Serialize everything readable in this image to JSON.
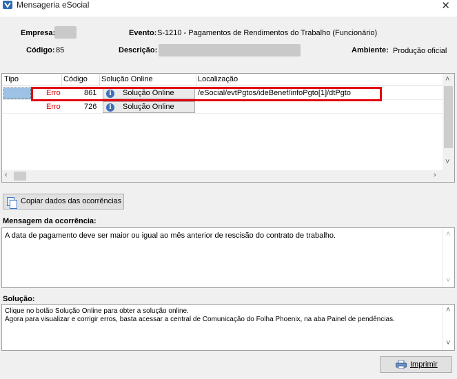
{
  "window": {
    "title": "Mensageria eSocial",
    "close_glyph": "✕"
  },
  "header": {
    "empresa_label": "Empresa:",
    "codigo_label": "Código:",
    "codigo_value": "85",
    "evento_label": "Evento:",
    "evento_value": "S-1210 - Pagamentos de Rendimentos do Trabalho (Funcionário)",
    "descricao_label": "Descrição:",
    "ambiente_label": "Ambiente:",
    "ambiente_value": "Produção oficial"
  },
  "grid": {
    "columns": [
      "Tipo",
      "Código",
      "Solução Online",
      "Localização"
    ],
    "rows": [
      {
        "tipo": "Erro",
        "codigo": "861",
        "solucao": "Solução Online",
        "localizacao": "/eSocial/evtPgtos/ideBenef/infoPgto[1]/dtPgto",
        "selected": true
      },
      {
        "tipo": "Erro",
        "codigo": "726",
        "solucao": "Solução Online",
        "localizacao": "",
        "selected": false
      }
    ]
  },
  "copy_button": {
    "label": "Copiar dados das ocorrências",
    "icon": "copy-icon"
  },
  "mensagem": {
    "label": "Mensagem da ocorrência:",
    "text": "A data de pagamento deve ser maior ou igual ao mês anterior de rescisão do contrato de trabalho."
  },
  "solucao": {
    "label": "Solução:",
    "line1": "Clique no botão Solução Online para obter a solução online.",
    "line2": "Agora para visualizar e corrigir erros, basta acessar a central de Comunicação do Folha Phoenix, na aba Painel de pendências."
  },
  "print_button": {
    "label": "Imprimir",
    "icon": "printer-icon"
  },
  "colors": {
    "error_text": "#e00000",
    "highlight_border": "#e3000f",
    "selection": "#9ec1e6"
  }
}
